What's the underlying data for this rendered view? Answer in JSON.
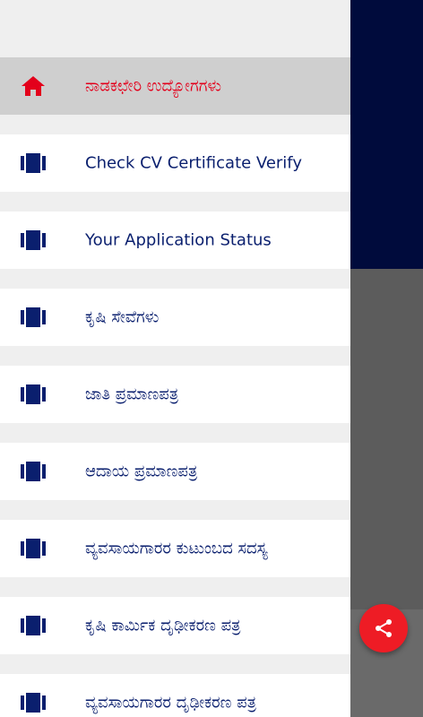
{
  "drawer": {
    "items": [
      {
        "label": "ನಾಡಕಛೇರಿ ಉದ್ಯೋಗಗಳು",
        "icon": "home-icon",
        "active": true
      },
      {
        "label": "Check CV Certificate Verify",
        "icon": "card-icon"
      },
      {
        "label": "Your Application Status",
        "icon": "card-icon"
      },
      {
        "label": "ಕೃಷಿ ಸೇವೆಗಳು",
        "icon": "card-icon"
      },
      {
        "label": "ಜಾತಿ ಪ್ರಮಾಣಪತ್ರ",
        "icon": "card-icon"
      },
      {
        "label": "ಆದಾಯ ಪ್ರಮಾಣಪತ್ರ",
        "icon": "card-icon"
      },
      {
        "label": "ವ್ಯವಸಾಯಗಾರರ ಕುಟುಂಬದ ಸದಸ್ಯ",
        "icon": "card-icon"
      },
      {
        "label": "ಕೃಷಿ ಕಾರ್ಮಿಕ ದೃಢೀಕರಣ ಪತ್ರ",
        "icon": "card-icon"
      },
      {
        "label": "ವ್ಯವಸಾಯಗಾರರ ದೃಢೀಕರಣ ಪತ್ರ",
        "icon": "card-icon"
      }
    ]
  },
  "fab": {
    "icon": "share-icon"
  },
  "colors": {
    "active_text": "#e3001b",
    "text": "#0a1f6e",
    "fab": "#ee1c25",
    "header_bg": "#000b3c"
  }
}
